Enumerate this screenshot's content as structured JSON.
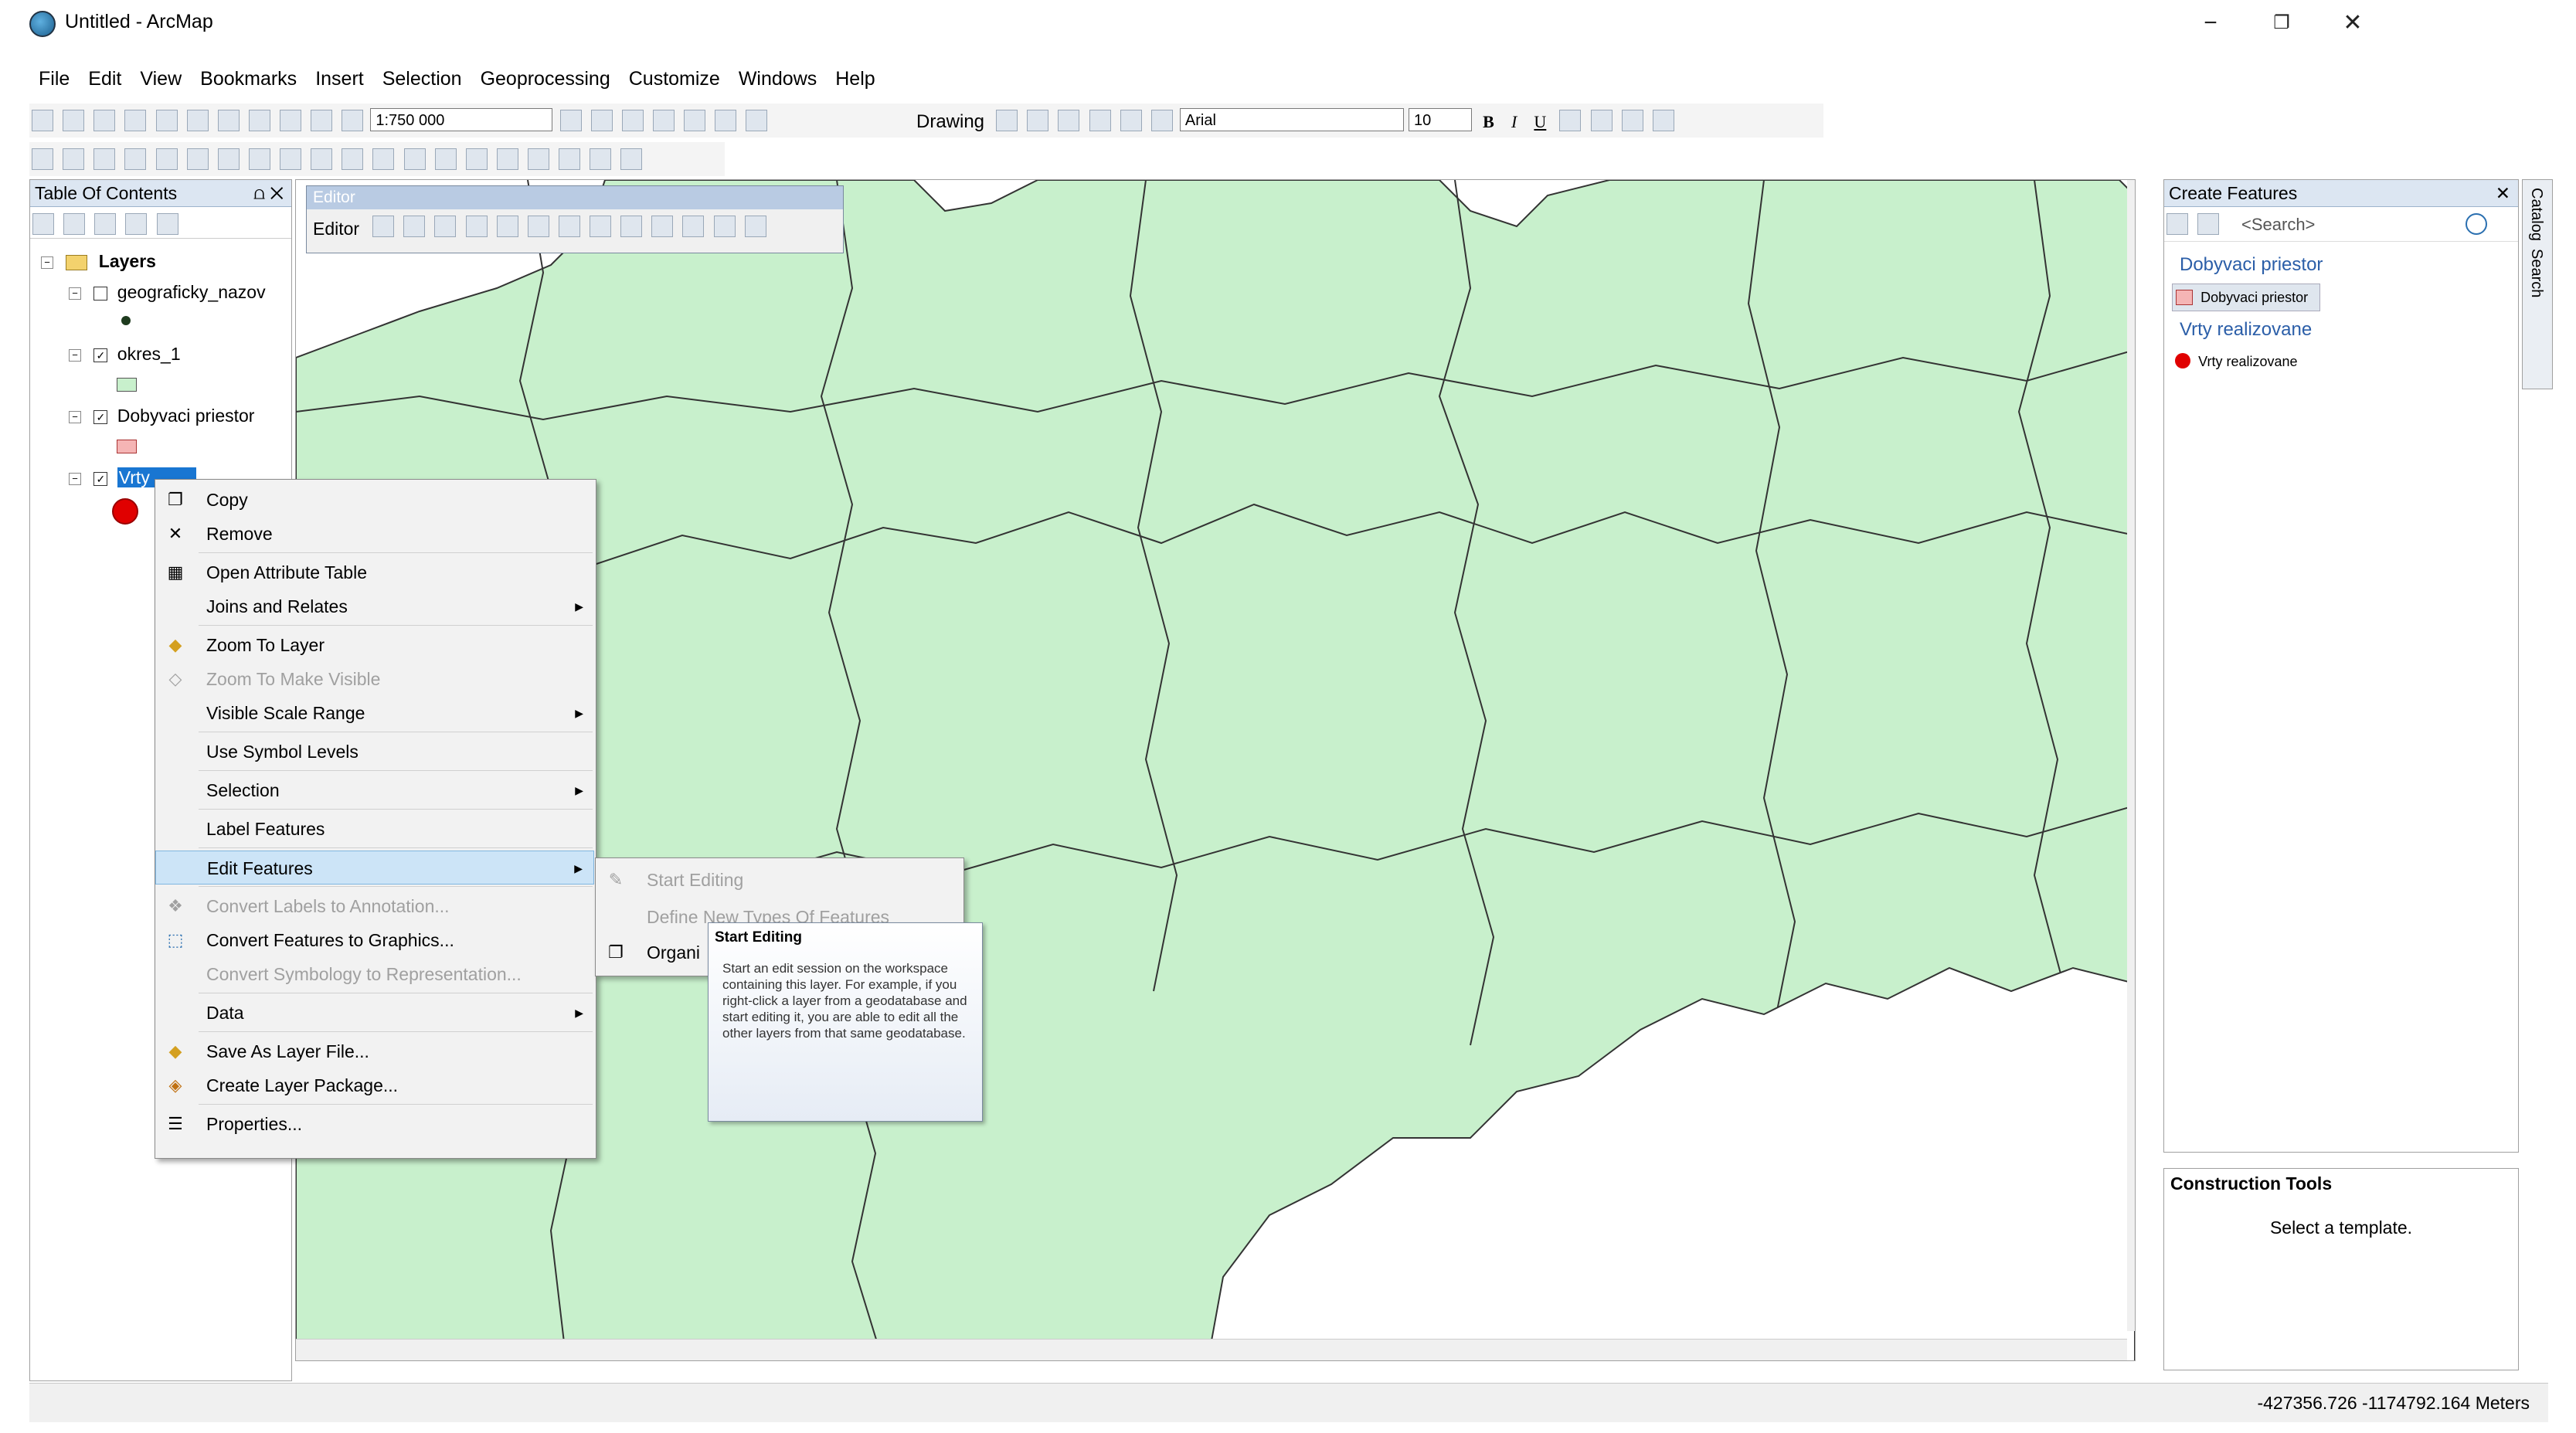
{
  "window": {
    "title": "Untitled - ArcMap",
    "minimize": "−",
    "restore": "❐",
    "close": "✕"
  },
  "menu": [
    "File",
    "Edit",
    "View",
    "Bookmarks",
    "Insert",
    "Selection",
    "Geoprocessing",
    "Customize",
    "Windows",
    "Help"
  ],
  "toolbar": {
    "scale": "1:750 000",
    "drawing_label": "Drawing",
    "font_name": "Arial",
    "font_size": "10",
    "bold": "B",
    "italic": "I",
    "underline": "U"
  },
  "toc": {
    "title": "Table Of Contents",
    "pin": "⩍ ✕",
    "layers_label": "Layers",
    "layers": [
      {
        "name": "geograficky_nazov",
        "checked": false
      },
      {
        "name": "okres_1",
        "checked": true
      },
      {
        "name": "Dobyvaci priestor",
        "checked": true
      },
      {
        "name": "Vrty realizovane",
        "checked": true,
        "visible_label": "Vrty"
      }
    ]
  },
  "editor_toolbar": {
    "title": "Editor",
    "menu_label": "Editor"
  },
  "context_menu": {
    "items": [
      {
        "label": "Copy",
        "icon": "copy-icon",
        "enabled": true
      },
      {
        "label": "Remove",
        "icon": "remove-icon",
        "enabled": true
      },
      {
        "label": "Open Attribute Table",
        "icon": "table-icon",
        "enabled": true
      },
      {
        "label": "Joins and Relates",
        "enabled": true,
        "submenu": true
      },
      {
        "label": "Zoom To Layer",
        "icon": "zoom-layer-icon",
        "enabled": true
      },
      {
        "label": "Zoom To Make Visible",
        "icon": "zoom-visible-icon",
        "enabled": false
      },
      {
        "label": "Visible Scale Range",
        "enabled": true,
        "submenu": true
      },
      {
        "label": "Use Symbol Levels",
        "enabled": true
      },
      {
        "label": "Selection",
        "enabled": true,
        "submenu": true
      },
      {
        "label": "Label Features",
        "enabled": true
      },
      {
        "label": "Edit Features",
        "enabled": true,
        "submenu": true,
        "highlighted": true
      },
      {
        "label": "Convert Labels to Annotation...",
        "icon": "annotation-icon",
        "enabled": false
      },
      {
        "label": "Convert Features to Graphics...",
        "icon": "graphics-icon",
        "enabled": true
      },
      {
        "label": "Convert Symbology to Representation...",
        "enabled": false
      },
      {
        "label": "Data",
        "enabled": true,
        "submenu": true
      },
      {
        "label": "Save As Layer File...",
        "icon": "layer-file-icon",
        "enabled": true
      },
      {
        "label": "Create Layer Package...",
        "icon": "package-icon",
        "enabled": true
      },
      {
        "label": "Properties...",
        "icon": "properties-icon",
        "enabled": true
      }
    ]
  },
  "submenu": {
    "items": [
      {
        "label": "Start Editing",
        "enabled": false
      },
      {
        "label": "Define New Types Of Features",
        "enabled": false
      },
      {
        "label": "Organi",
        "enabled": true
      }
    ]
  },
  "tooltip": {
    "title": "Start Editing",
    "body": "Start an edit session on the workspace containing this layer. For example, if you right-click a layer from a geodatabase and start editing it, you are able to edit all the other layers from that same geodatabase."
  },
  "create_features": {
    "title": "Create Features",
    "search_placeholder": "<Search>",
    "groups": [
      {
        "header": "Dobyvaci priestor",
        "template": "Dobyvaci priestor"
      },
      {
        "header": "Vrty realizovane",
        "template": "Vrty realizovane"
      }
    ]
  },
  "construction_tools": {
    "title": "Construction Tools",
    "message": "Select a template."
  },
  "side_tabs": [
    "Catalog",
    "Search"
  ],
  "status": {
    "coords": "-427356.726  -1174792.164 Meters"
  },
  "colors": {
    "polygon_fill": "#c8f0cc",
    "polygon_stroke": "#333333",
    "point": "#e00000",
    "highlight": "#cce4f7",
    "selected_layer": "#1976d2"
  }
}
